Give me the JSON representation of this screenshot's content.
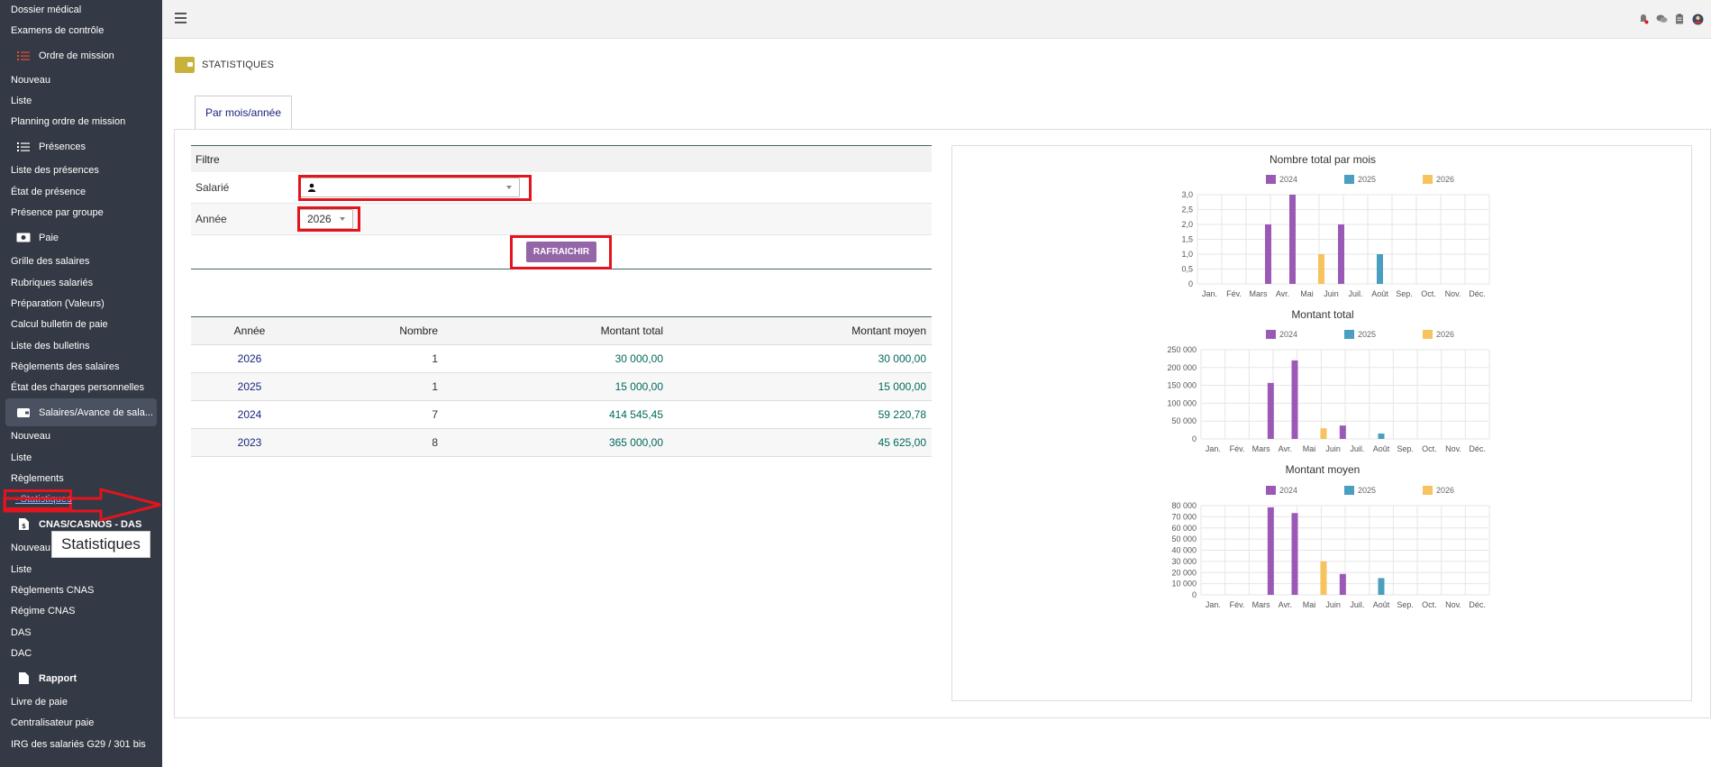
{
  "sidebar": {
    "items": [
      {
        "type": "item",
        "label": "Dossier médical"
      },
      {
        "type": "item",
        "label": "Examens de contrôle"
      },
      {
        "type": "section",
        "label": "Ordre de mission",
        "icon": "tasks-icon"
      },
      {
        "type": "item",
        "label": "Nouveau"
      },
      {
        "type": "item",
        "label": "Liste"
      },
      {
        "type": "item",
        "label": "Planning ordre de mission"
      },
      {
        "type": "section",
        "label": "Présences",
        "icon": "list-icon"
      },
      {
        "type": "item",
        "label": "Liste des présences"
      },
      {
        "type": "item",
        "label": "État de présence"
      },
      {
        "type": "item",
        "label": "Présence par groupe"
      },
      {
        "type": "section",
        "label": "Paie",
        "icon": "money-icon"
      },
      {
        "type": "item",
        "label": "Grille des salaires"
      },
      {
        "type": "item",
        "label": "Rubriques salariés"
      },
      {
        "type": "item",
        "label": "Préparation (Valeurs)"
      },
      {
        "type": "item",
        "label": "Calcul bulletin de paie"
      },
      {
        "type": "item",
        "label": "Liste des bulletins"
      },
      {
        "type": "item",
        "label": "Règlements des salaires"
      },
      {
        "type": "item",
        "label": "État des charges personnelles"
      },
      {
        "type": "section-active",
        "label": "Salaires/Avance de sala...",
        "icon": "wallet-icon"
      },
      {
        "type": "item",
        "label": "Nouveau"
      },
      {
        "type": "item",
        "label": "Liste"
      },
      {
        "type": "item",
        "label": "Règlements"
      },
      {
        "type": "current",
        "label": "Statistiques"
      },
      {
        "type": "section-bold",
        "label": "CNAS/CASNOS - DAS",
        "icon": "file-dollar-icon"
      },
      {
        "type": "item",
        "label": "Nouveau"
      },
      {
        "type": "item",
        "label": "Liste"
      },
      {
        "type": "item",
        "label": "Règlements CNAS"
      },
      {
        "type": "item",
        "label": "Régime CNAS"
      },
      {
        "type": "item",
        "label": "DAS"
      },
      {
        "type": "item",
        "label": "DAC"
      },
      {
        "type": "section-bold",
        "label": "Rapport",
        "icon": "file-icon"
      },
      {
        "type": "item",
        "label": "Livre de paie"
      },
      {
        "type": "item",
        "label": "Centralisateur paie"
      },
      {
        "type": "item",
        "label": "IRG des salariés G29 / 301 bis"
      }
    ],
    "tooltip": "Statistiques"
  },
  "page": {
    "title": "STATISTIQUES"
  },
  "tabs": [
    {
      "label": "Par mois/année"
    }
  ],
  "filter": {
    "title": "Filtre",
    "salarie_label": "Salarié",
    "annee_label": "Année",
    "annee_value": "2026",
    "refresh_label": "RAFRAICHIR"
  },
  "table": {
    "headers": [
      "Année",
      "Nombre",
      "Montant total",
      "Montant moyen"
    ],
    "rows": [
      [
        "2026",
        "1",
        "30 000,00",
        "30 000,00"
      ],
      [
        "2025",
        "1",
        "15 000,00",
        "15 000,00"
      ],
      [
        "2024",
        "7",
        "414 545,45",
        "59 220,78"
      ],
      [
        "2023",
        "8",
        "365 000,00",
        "45 625,00"
      ]
    ]
  },
  "colors": {
    "2024": "#9b59b6",
    "2025": "#4a9ebf",
    "2026": "#f7c35f",
    "highlight": "#e3141e"
  },
  "chart_data": [
    {
      "type": "bar",
      "title": "Nombre total par mois",
      "categories": [
        "Jan.",
        "Fév.",
        "Mars",
        "Avr.",
        "Mai",
        "Juin",
        "Juil.",
        "Août",
        "Sep.",
        "Oct.",
        "Nov.",
        "Déc."
      ],
      "series": [
        {
          "name": "2024",
          "values": [
            0,
            0,
            0,
            2,
            3,
            0,
            2,
            0,
            0,
            0,
            0,
            0
          ]
        },
        {
          "name": "2025",
          "values": [
            0,
            0,
            0,
            0,
            0,
            0,
            0,
            1,
            0,
            0,
            0,
            0
          ]
        },
        {
          "name": "2026",
          "values": [
            0,
            0,
            0,
            0,
            1,
            0,
            0,
            0,
            0,
            0,
            0,
            0
          ]
        }
      ],
      "ylim": [
        0,
        3
      ],
      "yticks": [
        "0",
        "0,5",
        "1,0",
        "1,5",
        "2,0",
        "2,5",
        "3,0"
      ],
      "legend": "top"
    },
    {
      "type": "bar",
      "title": "Montant total",
      "categories": [
        "Jan.",
        "Fév.",
        "Mars",
        "Avr.",
        "Mai",
        "Juin",
        "Juil.",
        "Août",
        "Sep.",
        "Oct.",
        "Nov.",
        "Déc."
      ],
      "series": [
        {
          "name": "2024",
          "values": [
            0,
            0,
            0,
            157000,
            220000,
            0,
            37545,
            0,
            0,
            0,
            0,
            0
          ]
        },
        {
          "name": "2025",
          "values": [
            0,
            0,
            0,
            0,
            0,
            0,
            0,
            15000,
            0,
            0,
            0,
            0
          ]
        },
        {
          "name": "2026",
          "values": [
            0,
            0,
            0,
            0,
            30000,
            0,
            0,
            0,
            0,
            0,
            0,
            0
          ]
        }
      ],
      "ylim": [
        0,
        250000
      ],
      "yticks": [
        "0",
        "50 000",
        "100 000",
        "150 000",
        "200 000",
        "250 000"
      ],
      "legend": "top"
    },
    {
      "type": "bar",
      "title": "Montant moyen",
      "categories": [
        "Jan.",
        "Fév.",
        "Mars",
        "Avr.",
        "Mai",
        "Juin",
        "Juil.",
        "Août",
        "Sep.",
        "Oct.",
        "Nov.",
        "Déc."
      ],
      "series": [
        {
          "name": "2024",
          "values": [
            0,
            0,
            0,
            78500,
            73333,
            0,
            18773,
            0,
            0,
            0,
            0,
            0
          ]
        },
        {
          "name": "2025",
          "values": [
            0,
            0,
            0,
            0,
            0,
            0,
            0,
            15000,
            0,
            0,
            0,
            0
          ]
        },
        {
          "name": "2026",
          "values": [
            0,
            0,
            0,
            0,
            30000,
            0,
            0,
            0,
            0,
            0,
            0,
            0
          ]
        }
      ],
      "ylim": [
        0,
        80000
      ],
      "yticks": [
        "0",
        "10 000",
        "20 000",
        "30 000",
        "40 000",
        "50 000",
        "60 000",
        "70 000",
        "80 000"
      ],
      "legend": "top"
    }
  ]
}
